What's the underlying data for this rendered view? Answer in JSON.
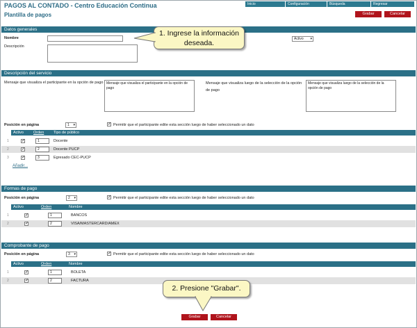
{
  "header": {
    "app_title": "PAGOS AL CONTADO - Centro Educación Continua",
    "page_title": "Plantilla de pagos",
    "nav": [
      "Inicio",
      "Configuración",
      "Búsqueda",
      "Regresar"
    ]
  },
  "buttons": {
    "save": "Grabar",
    "cancel": "Cancelar"
  },
  "general": {
    "section_title": "Datos generales",
    "name_label": "Nombre",
    "name_value": "",
    "description_label": "Descripción",
    "description_value": "",
    "status_value": "Activo"
  },
  "service": {
    "section_title": "Descripción del servicio",
    "msg_payment_label": "Mensaje que visualiza el participante en la opción de pago",
    "msg_payment_value": "Mensaje que visualiza el participante en la opción de pago",
    "msg_after_label": "Mensaje que visualiza luego de la selección de la opción de pago",
    "msg_after_value": "Mensaje que visualiza luego de la selección de la opción de pago",
    "position_label": "Posición en página",
    "position_value": "1",
    "allow_edit_label": "Permitir que el participante edite esta sección luego de haber seleccionado un dato",
    "columns": {
      "active": "Activo",
      "order": "Orden",
      "type": "Tipo de público"
    },
    "rows": [
      {
        "num": "1",
        "order": "1",
        "label": "Docente"
      },
      {
        "num": "2",
        "order": "2",
        "label": "Docente PUCP"
      },
      {
        "num": "3",
        "order": "3",
        "label": "Egresado CEC-PUCP"
      }
    ],
    "add_link": "Añadir..."
  },
  "payment_forms": {
    "section_title": "Formas de pago",
    "position_label": "Posición en página",
    "position_value": "2",
    "allow_edit_label": "Permitir que el participante edite esta sección luego de haber seleccionado un dato",
    "columns": {
      "active": "Activo",
      "order": "Orden",
      "name": "Nombre"
    },
    "rows": [
      {
        "num": "1",
        "order": "1",
        "label": "BANCOS"
      },
      {
        "num": "2",
        "order": "2",
        "label": "VISA/MASTERCARD/AMEX"
      }
    ]
  },
  "receipt": {
    "section_title": "Comprobante de pago",
    "position_label": "Posición en página",
    "position_value": "3",
    "allow_edit_label": "Permitir que el participante edite esta sección luego de haber seleccionado un dato",
    "columns": {
      "active": "Activo",
      "order": "Orden",
      "name": "Nombre"
    },
    "rows": [
      {
        "num": "1",
        "order": "1",
        "label": "BOLETA"
      },
      {
        "num": "2",
        "order": "2",
        "label": "FACTURA"
      }
    ]
  },
  "callouts": {
    "one_line1": "1. Ingrese la información",
    "one_line2": "deseada.",
    "two": "2. Presione \"Grabar\"."
  },
  "icons": {
    "check": "✓",
    "dropdown": "▾"
  },
  "colors": {
    "section_bar": "#2b7087",
    "button": "#b0141c",
    "title": "#2d6c86",
    "callout": "#fbf7c4"
  }
}
